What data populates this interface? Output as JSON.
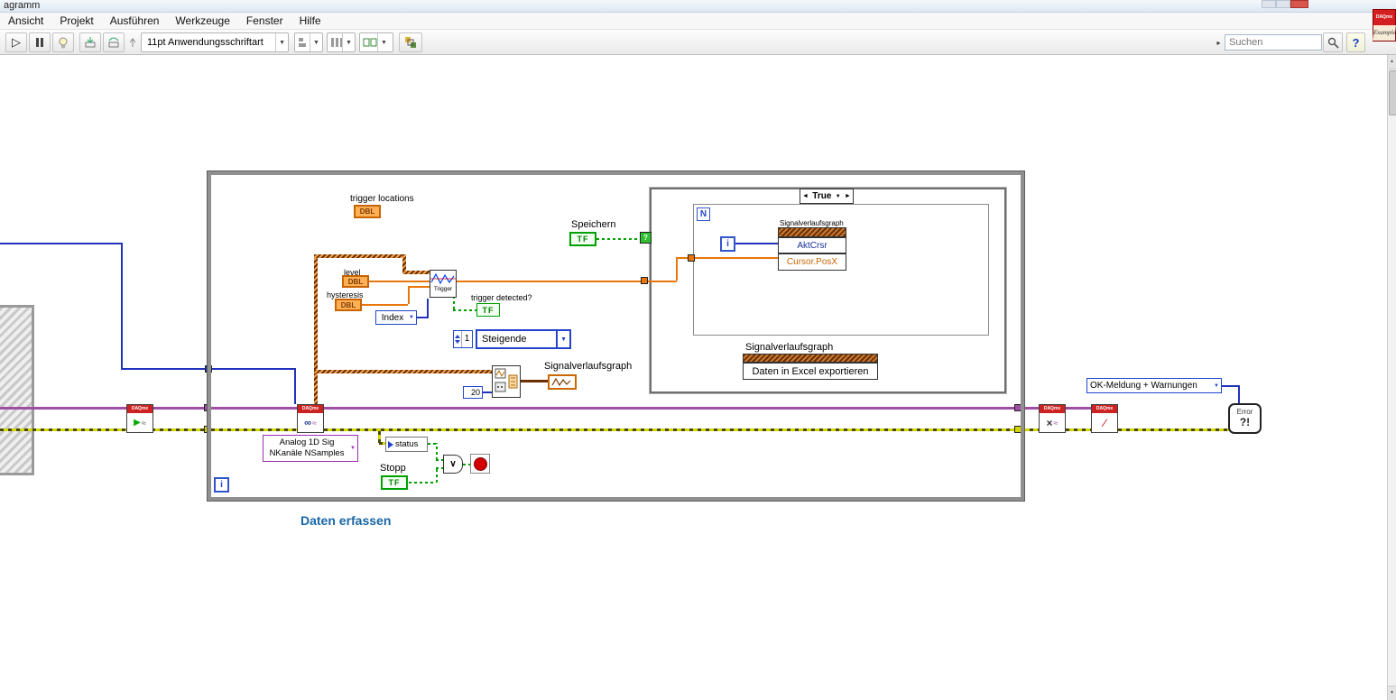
{
  "window": {
    "title_fragment": "agramm"
  },
  "menubar": [
    "Ansicht",
    "Projekt",
    "Ausführen",
    "Werkzeuge",
    "Fenster",
    "Hilfe"
  ],
  "toolbar": {
    "font_selector": "11pt Anwendungsschriftart",
    "search_placeholder": "Suchen",
    "help": "?"
  },
  "side_window": {
    "brand": "DAQmx",
    "name": "Example"
  },
  "icons": {
    "run": "▷",
    "dropdown": "▼",
    "up": "▲",
    "sel_left": "◄",
    "sel_right": "►",
    "search_toggle": "▸",
    "or": "∨",
    "infinity": "∞",
    "wave": "≈",
    "clear_x": "×",
    "play": "▶",
    "slash": "/"
  },
  "diagram": {
    "daqmx_label": "DAQmx",
    "trigger_locations_label": "trigger locations",
    "dbl": "DBL",
    "tf": "TF",
    "level_label": "level",
    "hysteresis_label": "hysteresis",
    "trigger_vi_label": "Trigger",
    "trigger_detected_label": "trigger detected?",
    "speichern_label": "Speichern",
    "index_selector": "Index",
    "numeric_one": "1",
    "edge_selector": "Steigende",
    "numeric_twenty": "20",
    "graph_label": "Signalverlaufsgraph",
    "case_selector": "True",
    "for_loop_count": "N",
    "iteration": "i",
    "case_question": "?",
    "property_node": {
      "title": "Signalverlaufsgraph",
      "row1": "AktCrsr",
      "row2": "Cursor.PosX"
    },
    "invoke_node": {
      "title": "Signalverlaufsgraph",
      "method": "Daten in Excel exportieren"
    },
    "poly_selector": {
      "line1": "Analog 1D Sig",
      "line2": "NKanäle NSamples"
    },
    "status_label": "status",
    "stopp_label": "Stopp",
    "error_handler_mode": "OK-Meldung + Warnungen",
    "error_icon": {
      "line1": "Error",
      "line2": "?!"
    },
    "frame_caption": "Daten erfassen"
  }
}
